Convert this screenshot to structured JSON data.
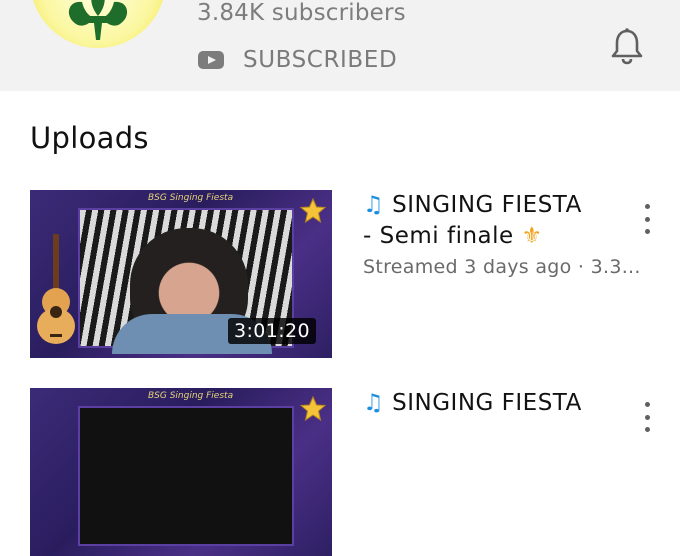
{
  "channel": {
    "subscribers": "3.84K subscribers",
    "subscribed_label": "SUBSCRIBED",
    "accent_color": "#ff0000"
  },
  "section": {
    "title": "Uploads"
  },
  "videos": [
    {
      "title_line1": "SINGING FIESTA",
      "title_line2": "- Semi finale",
      "meta": "Streamed 3 days ago · 3.3...",
      "duration": "3:01:20",
      "thumb_caption": "BSG Singing Fiesta"
    },
    {
      "title_line1": "SINGING FIESTA",
      "thumb_caption": "BSG Singing Fiesta"
    }
  ],
  "icons": {
    "note": "♫",
    "fleur": "⚜"
  }
}
